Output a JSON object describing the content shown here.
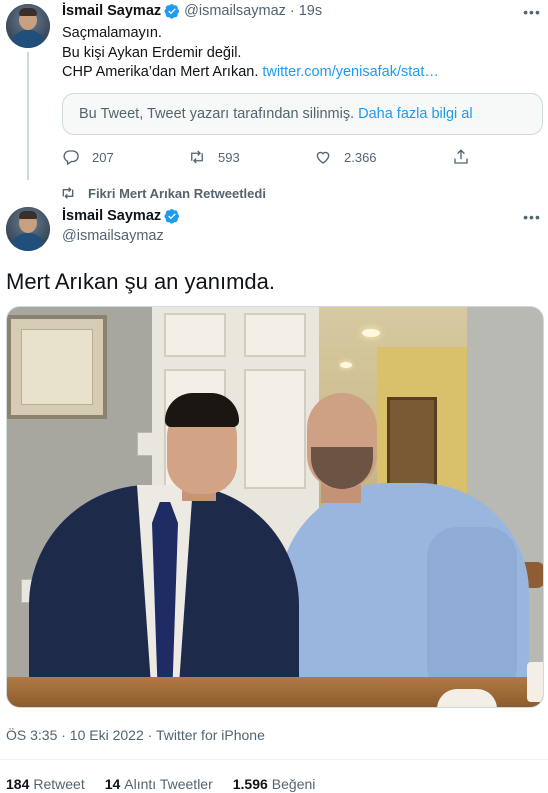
{
  "tweet1": {
    "author_name": "İsmail Saymaz",
    "author_handle": "@ismailsaymaz",
    "time": "19s",
    "lines": [
      "Saçmalamayın.",
      "Bu kişi Aykan Erdemir değil.",
      "CHP Amerika’dan Mert Arıkan."
    ],
    "link_text": "twitter.com/yenisafak/stat…",
    "quote_notice": "Bu Tweet, Tweet yazarı tarafından silinmiş.",
    "quote_more": "Daha fazla bilgi al",
    "replies": "207",
    "retweets": "593",
    "likes": "2.366"
  },
  "retweet_context": "Fikri Mert Arıkan Retweetledi",
  "tweet2": {
    "author_name": "İsmail Saymaz",
    "author_handle": "@ismailsaymaz",
    "text": "Mert Arıkan şu an yanımda.",
    "meta": "ÖS 3:35 · 10 Eki 2022 · Twitter for iPhone",
    "stats": {
      "retweet_count": "184",
      "retweet_label": "Retweet",
      "quote_count": "14",
      "quote_label": "Alıntı Tweetler",
      "like_count": "1.596",
      "like_label": "Beğeni"
    }
  },
  "icons": [
    "verified-badge-icon",
    "more-icon",
    "reply-icon",
    "retweet-icon",
    "like-icon",
    "share-icon"
  ],
  "colors": {
    "accent": "#1d9bf0",
    "secondary_text": "#536471",
    "primary_text": "#0f1419",
    "border": "#cfd9de"
  }
}
